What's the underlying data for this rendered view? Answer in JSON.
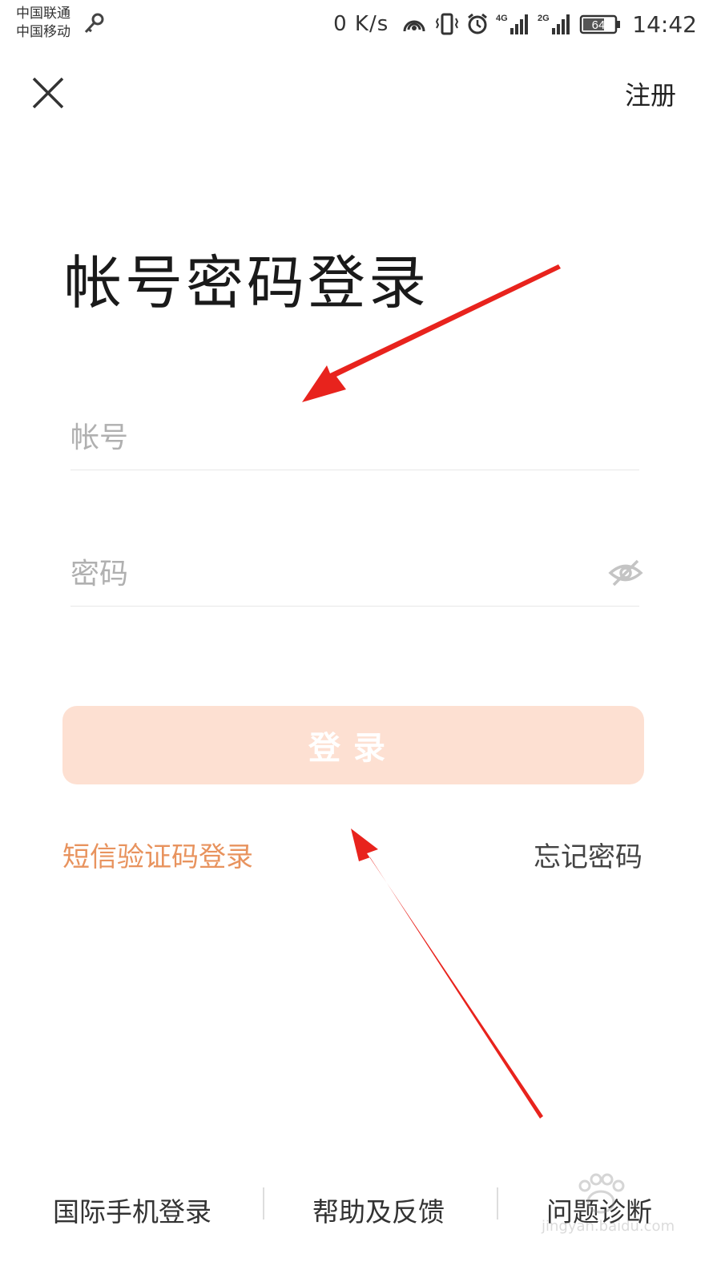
{
  "status_bar": {
    "carrier1": "中国联通",
    "carrier2": "中国移动",
    "net_speed": "0 K/s",
    "battery": "64",
    "time": "14:42",
    "net_badge_1": "4G",
    "net_badge_2": "2G",
    "icons": [
      "key-icon",
      "hotspot-icon",
      "vibrate-icon",
      "alarm-icon",
      "signal-4g-icon",
      "signal-2g-icon",
      "battery-icon"
    ]
  },
  "nav": {
    "register_label": "注册"
  },
  "title": "帐号密码登录",
  "form": {
    "account_placeholder": "帐号",
    "password_placeholder": "密码",
    "login_label": "登录"
  },
  "links": {
    "sms_login": "短信验证码登录",
    "forgot_password": "忘记密码"
  },
  "footer": {
    "international": "国际手机登录",
    "help": "帮助及反馈",
    "diagnose": "问题诊断"
  },
  "watermark": {
    "text": "jingyan.baidu.com"
  },
  "colors": {
    "accent": "#e8935e",
    "button_bg": "#fde0d2",
    "annotation_arrow": "#e8231d"
  }
}
